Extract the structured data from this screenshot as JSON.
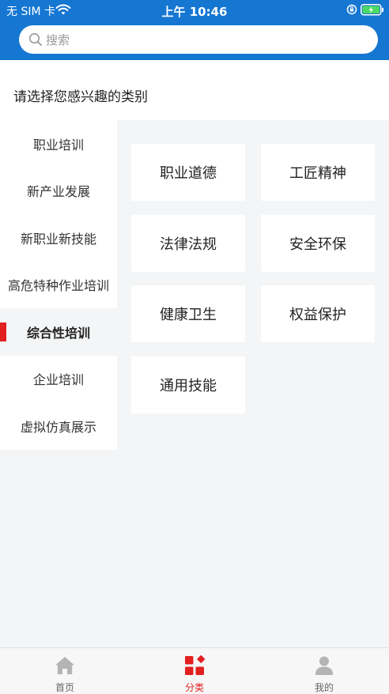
{
  "status_bar": {
    "carrier": "无 SIM 卡",
    "time": "上午 10:46"
  },
  "search": {
    "placeholder": "搜索"
  },
  "section_title": "请选择您感兴趣的类别",
  "sidebar": {
    "items": [
      {
        "label": "职业培训",
        "active": false
      },
      {
        "label": "新产业发展",
        "active": false
      },
      {
        "label": "新职业新技能",
        "active": false
      },
      {
        "label": "高危特种作业培训",
        "active": false
      },
      {
        "label": "综合性培训",
        "active": true
      },
      {
        "label": "企业培训",
        "active": false
      },
      {
        "label": "虚拟仿真展示",
        "active": false
      }
    ]
  },
  "categories": [
    {
      "label": "职业道德"
    },
    {
      "label": "工匠精神"
    },
    {
      "label": "法律法规"
    },
    {
      "label": "安全环保"
    },
    {
      "label": "健康卫生"
    },
    {
      "label": "权益保护"
    },
    {
      "label": "通用技能"
    }
  ],
  "tabbar": {
    "tabs": [
      {
        "label": "首页",
        "icon": "home-icon",
        "active": false
      },
      {
        "label": "分类",
        "icon": "category-icon",
        "active": true
      },
      {
        "label": "我的",
        "icon": "user-icon",
        "active": false
      }
    ]
  },
  "colors": {
    "header": "#1677d2",
    "accent": "#e32020",
    "panel_bg": "#f4f5f6",
    "battery": "#4cd964"
  }
}
